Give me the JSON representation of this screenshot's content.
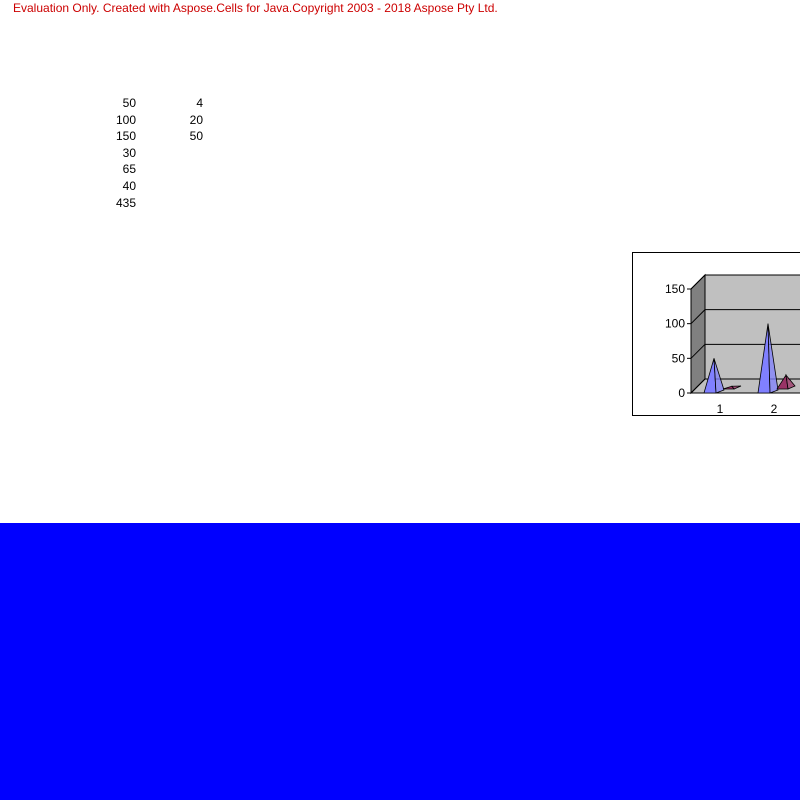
{
  "banner": {
    "text": "Evaluation Only. Created with Aspose.Cells for Java.Copyright 2003 - 2018 Aspose Pty Ltd.",
    "color": "#cc0000"
  },
  "sheet": {
    "column_a": [
      "50",
      "100",
      "150",
      "30",
      "65",
      "40",
      "435"
    ],
    "column_b": [
      "4",
      "20",
      "50"
    ]
  },
  "chart_data": {
    "type": "bar",
    "bar_shape": "3d-pyramid",
    "categories": [
      "1",
      "2"
    ],
    "series": [
      {
        "values": [
          50,
          100
        ],
        "color": "#8080ff"
      },
      {
        "values": [
          4,
          20
        ],
        "color": "#993366"
      }
    ],
    "ylim": [
      0,
      150
    ],
    "yticks": [
      "0",
      "50",
      "100",
      "150"
    ],
    "grid": true,
    "legend": "none",
    "plot_background": "#c0c0c0"
  },
  "band": {
    "color": "#0000ff"
  }
}
